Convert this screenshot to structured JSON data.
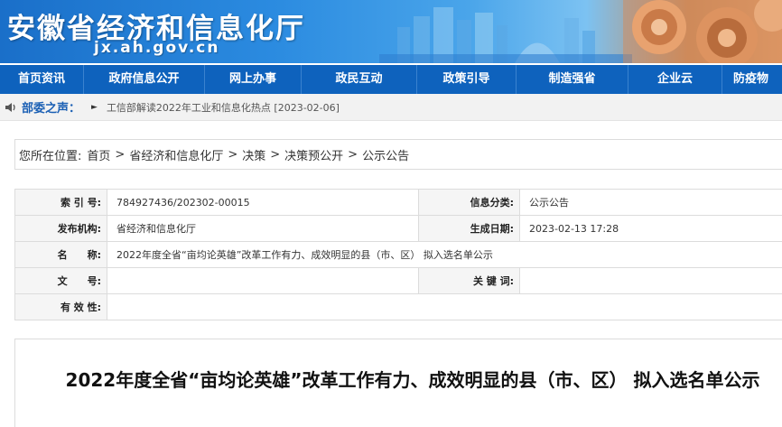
{
  "header": {
    "title": "安徽省经济和信息化厅",
    "domain": "jx.ah.gov.cn"
  },
  "nav": [
    {
      "label": "首页资讯"
    },
    {
      "label": "政府信息公开"
    },
    {
      "label": "网上办事"
    },
    {
      "label": "政民互动"
    },
    {
      "label": "政策引导"
    },
    {
      "label": "制造强省"
    },
    {
      "label": "企业云"
    },
    {
      "label": "防疫物"
    }
  ],
  "announcement": {
    "label": "部委之声：",
    "arrow": "►",
    "news": "工信部解读2022年工业和信息化热点 [2023-02-06]"
  },
  "breadcrumb": {
    "prefix": "您所在位置:",
    "items": [
      "首页",
      "省经济和信息化厅",
      "决策",
      "决策预公开",
      "公示公告"
    ],
    "separator": ">"
  },
  "meta": {
    "index_label": "索 引 号:",
    "index_value": "784927436/202302-00015",
    "category_label": "信息分类:",
    "category_value": "公示公告",
    "publisher_label": "发布机构:",
    "publisher_value": "省经济和信息化厅",
    "date_label": "生成日期:",
    "date_value": "2023-02-13 17:28",
    "name_label": "名　　称:",
    "name_value": "2022年度全省“亩均论英雄”改革工作有力、成效明显的县（市、区） 拟入选名单公示",
    "docno_label": "文　　号:",
    "docno_value": "",
    "keywords_label": "关 键 词:",
    "keywords_value": "",
    "validity_label": "有 效 性:",
    "validity_value": ""
  },
  "article": {
    "title": "2022年度全省“亩均论英雄”改革工作有力、成效明显的县（市、区） 拟入选名单公示"
  },
  "colors": {
    "nav_bg": "#0e62bd",
    "accent": "#1a5fb4"
  }
}
